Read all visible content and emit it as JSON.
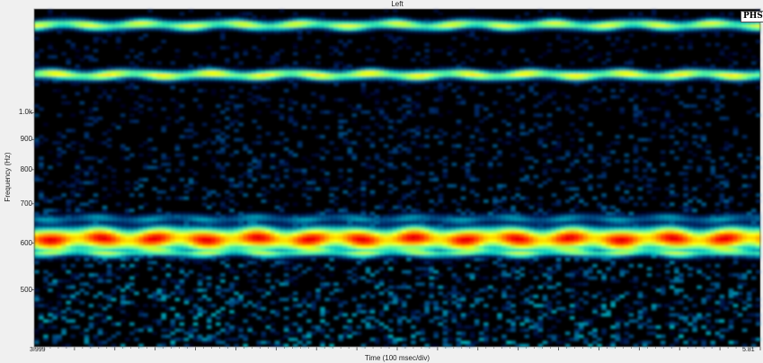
{
  "chart_data": {
    "type": "heatmap",
    "title": "Left",
    "xlabel": "Time (100 msec/div)",
    "ylabel": "Frequency (Hz)",
    "x_start_label": "3.999",
    "x_end_label": "5.81",
    "xlim": [
      3.999,
      5.81
    ],
    "ylim": [
      400,
      1500
    ],
    "y_scale": "log",
    "y_ticks": [
      {
        "value": 500,
        "label": "500"
      },
      {
        "value": 600,
        "label": "600"
      },
      {
        "value": 700,
        "label": "700"
      },
      {
        "value": 800,
        "label": "800"
      },
      {
        "value": 900,
        "label": "900"
      },
      {
        "value": 1000,
        "label": "1.0k"
      }
    ],
    "x_major_divisions": 18,
    "bands": [
      {
        "freq": 1410,
        "intensity": 0.6
      },
      {
        "freq": 1160,
        "intensity": 0.65
      },
      {
        "freq": 610,
        "intensity": 0.95
      },
      {
        "freq": 580,
        "intensity": 0.55
      },
      {
        "freq": 660,
        "intensity": 0.3
      }
    ],
    "badge": "PHS",
    "colors": {
      "background": "#000000",
      "low": "#0000ff",
      "mid": "#00ff66",
      "high": "#ff2000"
    }
  }
}
